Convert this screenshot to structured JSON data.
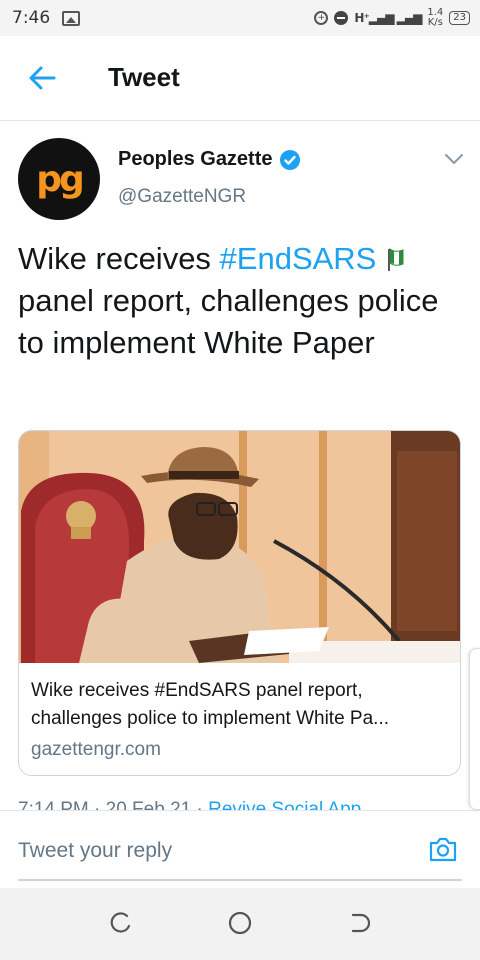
{
  "status_bar": {
    "time": "7:46",
    "network_speed_value": "1.4",
    "network_speed_unit": "K/s",
    "battery": "23"
  },
  "header": {
    "title": "Tweet"
  },
  "tweet": {
    "author_name": "Peoples Gazette",
    "author_handle": "@GazetteNGR",
    "avatar_text": "pg",
    "text_before": "Wike receives ",
    "hashtag": "#EndSARS",
    "text_after": " panel report, challenges police to implement White Paper",
    "card": {
      "title_line1": "Wike receives #EndSARS panel report,",
      "title_line2": "challenges police to implement White Pa...",
      "domain": "gazettengr.com"
    },
    "timestamp": "7:14 PM · 20 Feb 21 · ",
    "source_app": "Revive Social App"
  },
  "reply": {
    "placeholder": "Tweet your reply"
  },
  "colors": {
    "accent": "#1da1f2",
    "secondary_text": "#657786",
    "brand_orange": "#f7941d"
  }
}
